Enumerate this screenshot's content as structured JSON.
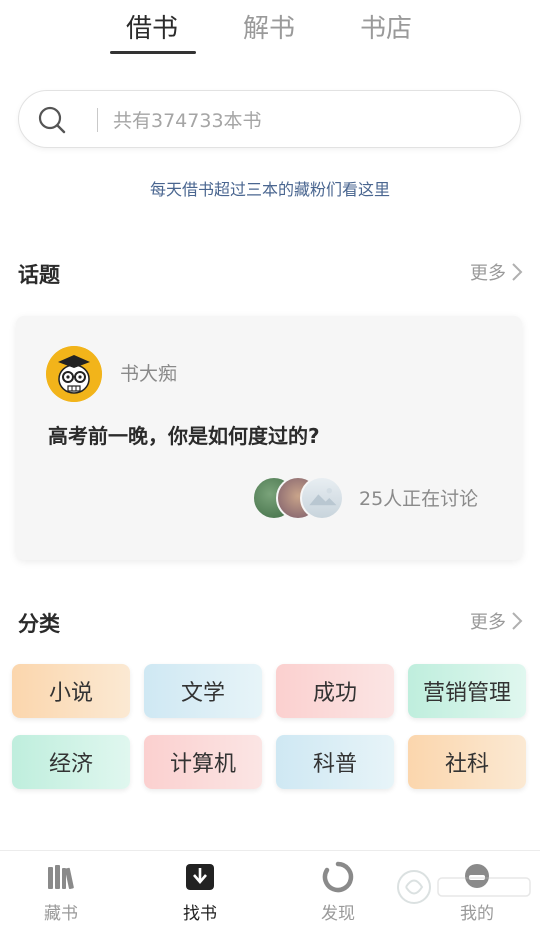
{
  "top_tabs": [
    {
      "label": "借书",
      "active": true
    },
    {
      "label": "解书",
      "active": false
    },
    {
      "label": "书店",
      "active": false
    }
  ],
  "search": {
    "placeholder": "共有374733本书",
    "icon": "search-icon"
  },
  "promo_link": "每天借书超过三本的藏粉们看这里",
  "topics_section": {
    "title": "话题",
    "more": "更多",
    "card": {
      "author": "书大痴",
      "title": "高考前一晚，你是如何度过的?",
      "discuss_count": "25人正在讨论"
    }
  },
  "category_section": {
    "title": "分类",
    "more": "更多",
    "items": [
      {
        "label": "小说",
        "colors": [
          "#fbd6ad",
          "#fbe9d3"
        ]
      },
      {
        "label": "文学",
        "colors": [
          "#cfe8f3",
          "#e7f4f8"
        ]
      },
      {
        "label": "成功",
        "colors": [
          "#fbd0cf",
          "#fbe5e4"
        ]
      },
      {
        "label": "营销管理",
        "colors": [
          "#bfeedd",
          "#e0f7ef"
        ]
      },
      {
        "label": "经济",
        "colors": [
          "#bfeedd",
          "#e0f7ef"
        ]
      },
      {
        "label": "计算机",
        "colors": [
          "#fbd0cf",
          "#fbe5e4"
        ]
      },
      {
        "label": "科普",
        "colors": [
          "#cfe8f3",
          "#e7f4f8"
        ]
      },
      {
        "label": "社科",
        "colors": [
          "#fbd6ad",
          "#fbe9d3"
        ]
      }
    ]
  },
  "bottom_nav": [
    {
      "label": "藏书",
      "icon": "bookshelf-icon",
      "active": false
    },
    {
      "label": "找书",
      "icon": "find-book-icon",
      "active": true
    },
    {
      "label": "发现",
      "icon": "discover-icon",
      "active": false
    },
    {
      "label": "我的",
      "icon": "profile-icon",
      "active": false
    }
  ],
  "colors": {
    "accent": "#2b2b2b",
    "link": "#4a6690",
    "avatar_bg": "#f2b41a"
  }
}
